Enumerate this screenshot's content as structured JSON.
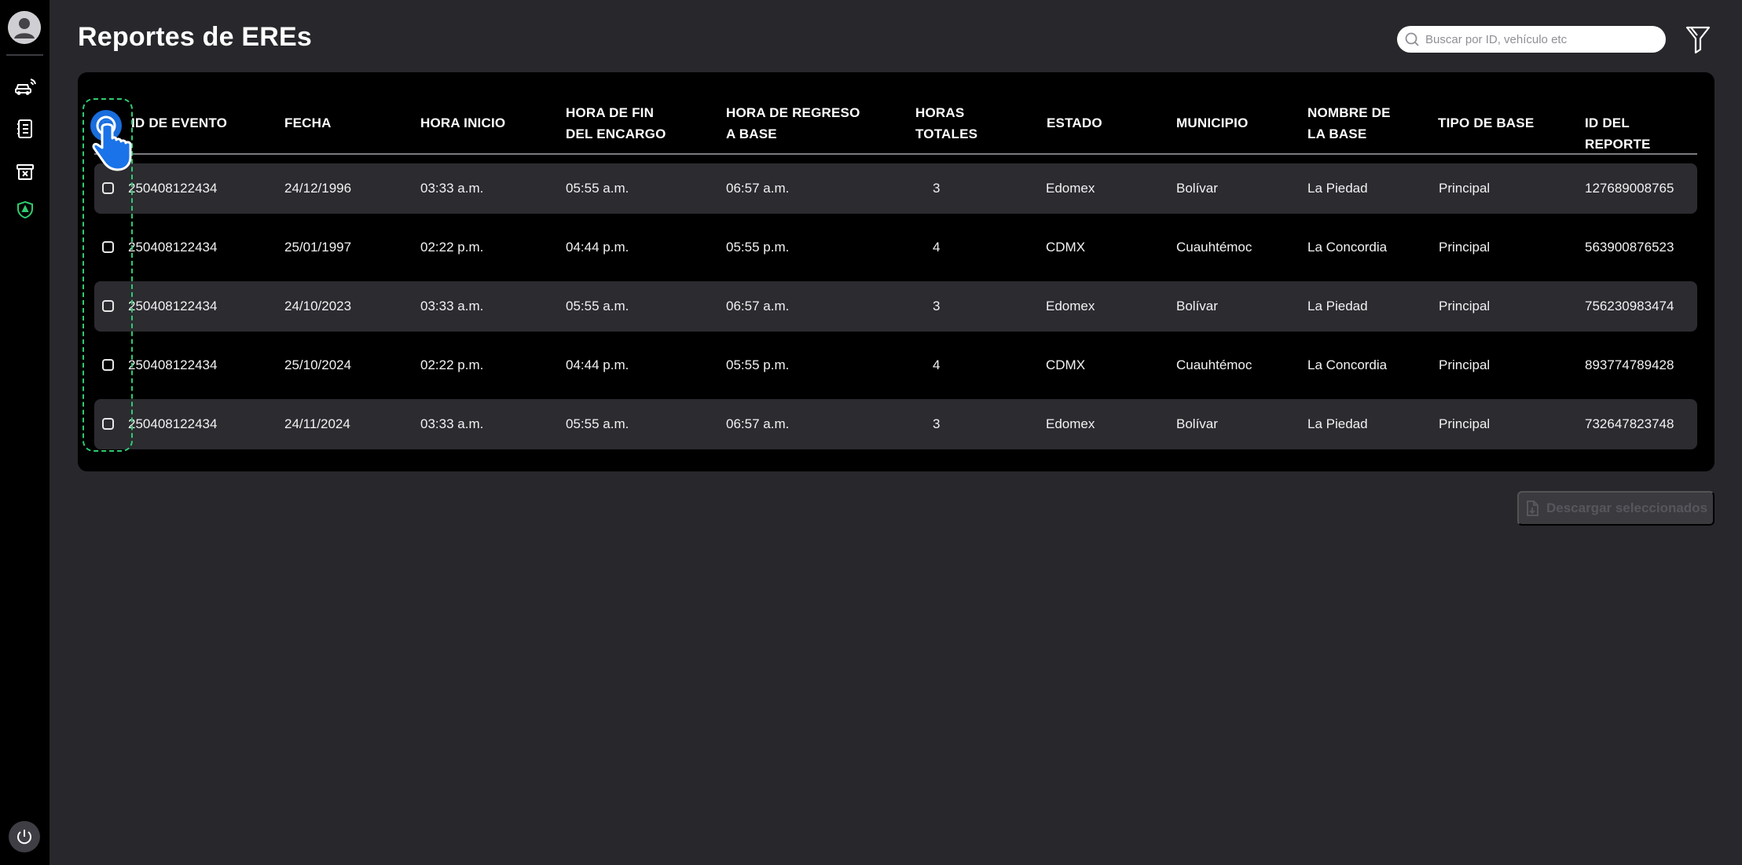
{
  "page": {
    "title": "Reportes de EREs"
  },
  "sidebar": {
    "items": [
      {
        "icon": "user-avatar-icon"
      },
      {
        "icon": "vehicle-signal-icon"
      },
      {
        "icon": "report-list-icon"
      },
      {
        "icon": "archive-box-x-icon"
      },
      {
        "icon": "shield-badge-icon",
        "active": true
      },
      {
        "icon": "power-icon"
      }
    ],
    "active_color": "#2ecc71"
  },
  "search": {
    "placeholder": "Buscar por ID, vehículo etc",
    "value": ""
  },
  "table": {
    "headers": {
      "id_evento": "ID DE EVENTO",
      "fecha": "FECHA",
      "hora_inicio": "HORA INICIO",
      "hora_fin_l1": "HORA DE FIN",
      "hora_fin_l2": "DEL ENCARGO",
      "hora_regreso_l1": "HORA DE REGRESO",
      "hora_regreso_l2": "A BASE",
      "horas_totales_l1": "HORAS",
      "horas_totales_l2": "TOTALES",
      "estado": "ESTADO",
      "municipio": "MUNICIPIO",
      "nombre_base_l1": "NOMBRE DE",
      "nombre_base_l2": "LA BASE",
      "tipo_base": "TIPO DE BASE",
      "id_reporte": "ID DEL REPORTE"
    },
    "rows": [
      {
        "id_evento": "250408122434",
        "fecha": "24/12/1996",
        "hora_inicio": "03:33 a.m.",
        "hora_fin": "05:55 a.m.",
        "hora_regreso": "06:57 a.m.",
        "horas_totales": "3",
        "estado": "Edomex",
        "municipio": "Bolívar",
        "nombre_base": "La Piedad",
        "tipo_base": "Principal",
        "id_reporte": "127689008765"
      },
      {
        "id_evento": "250408122434",
        "fecha": "25/01/1997",
        "hora_inicio": "02:22 p.m.",
        "hora_fin": "04:44 p.m.",
        "hora_regreso": "05:55 p.m.",
        "horas_totales": "4",
        "estado": "CDMX",
        "municipio": "Cuauhtémoc",
        "nombre_base": "La Concordia",
        "tipo_base": "Principal",
        "id_reporte": "563900876523"
      },
      {
        "id_evento": "250408122434",
        "fecha": "24/10/2023",
        "hora_inicio": "03:33 a.m.",
        "hora_fin": "05:55 a.m.",
        "hora_regreso": "06:57 a.m.",
        "horas_totales": "3",
        "estado": "Edomex",
        "municipio": "Bolívar",
        "nombre_base": "La Piedad",
        "tipo_base": "Principal",
        "id_reporte": "756230983474"
      },
      {
        "id_evento": "250408122434",
        "fecha": "25/10/2024",
        "hora_inicio": "02:22 p.m.",
        "hora_fin": "04:44 p.m.",
        "hora_regreso": "05:55 p.m.",
        "horas_totales": "4",
        "estado": "CDMX",
        "municipio": "Cuauhtémoc",
        "nombre_base": "La Concordia",
        "tipo_base": "Principal",
        "id_reporte": "893774789428"
      },
      {
        "id_evento": "250408122434",
        "fecha": "24/11/2024",
        "hora_inicio": "03:33 a.m.",
        "hora_fin": "05:55 a.m.",
        "hora_regreso": "06:57 a.m.",
        "horas_totales": "3",
        "estado": "Edomex",
        "municipio": "Bolívar",
        "nombre_base": "La Piedad",
        "tipo_base": "Principal",
        "id_reporte": "732647823748"
      }
    ]
  },
  "actions": {
    "download_label": "Descargar seleccionados",
    "download_enabled": false
  },
  "colors": {
    "background": "#27272c",
    "panel": "#000000",
    "row_shaded": "#2b2b30",
    "highlight": "#2ecc71",
    "pointer": "#1a73e8"
  }
}
